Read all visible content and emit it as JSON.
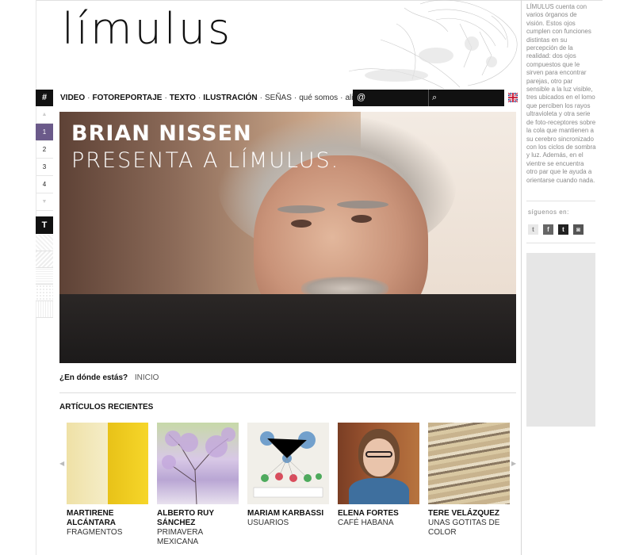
{
  "site": {
    "logo": "límulus"
  },
  "nav": {
    "hash": "#",
    "links": [
      {
        "label": "VIDEO",
        "style": "strong"
      },
      {
        "label": "FOTOREPORTAJE",
        "style": "strong"
      },
      {
        "label": "TEXTO",
        "style": "strong"
      },
      {
        "label": "ILUSTRACIÓN",
        "style": "strong"
      },
      {
        "label": "SEÑAS",
        "style": "light"
      },
      {
        "label": "qué somos",
        "style": "light"
      },
      {
        "label": "aliados",
        "style": "light"
      }
    ],
    "separator": "·",
    "email_icon": "@",
    "search_icon": "⌕",
    "language_flag": "uk-flag-icon"
  },
  "slides": {
    "numbers": [
      "1",
      "2",
      "3",
      "4"
    ],
    "active": "1",
    "up": "▲",
    "down": "▼",
    "text_toggle": "T"
  },
  "hero": {
    "line1": "BRIAN NISSEN",
    "line2": "PRESENTA A LÍMULUS."
  },
  "breadcrumb": {
    "question": "¿En dónde estás?",
    "current": "INICIO"
  },
  "recent": {
    "title": "ARTÍCULOS RECIENTES",
    "prev": "◀",
    "next": "▶",
    "items": [
      {
        "name": "MARTIRENE ALCÁNTARA",
        "sub": "FRAGMENTOS"
      },
      {
        "name": "ALBERTO RUY SÁNCHEZ",
        "sub": "PRIMAVERA MEXICANA"
      },
      {
        "name": "MARIAM KARBASSI",
        "sub": "USUARIOS"
      },
      {
        "name": "ELENA FORTES",
        "sub": "CAFÉ HABANA"
      },
      {
        "name": "TERE VELÁZQUEZ",
        "sub": "UNAS GOTITAS DE COLOR"
      }
    ]
  },
  "sidebar": {
    "about": "LÍMULUS cuenta con varios órganos de visión. Estos ojos cumplen con funciones distintas en su percepción de la realidad: dos ojos compuestos que le sirven para encontrar parejas, otro par sensible a la luz visible, tres ubicados en el lomo que perciben los rayos ultravioleta y otra serie de foto-receptores sobre la cola que mantienen a su cerebro sincronizado con los ciclos de sombra y luz. Además, en el vientre se encuentra otro par que le ayuda a orientarse cuando nada.",
    "follow": "síguenos en:",
    "socials": [
      "t",
      "f",
      "t",
      "◙"
    ]
  }
}
